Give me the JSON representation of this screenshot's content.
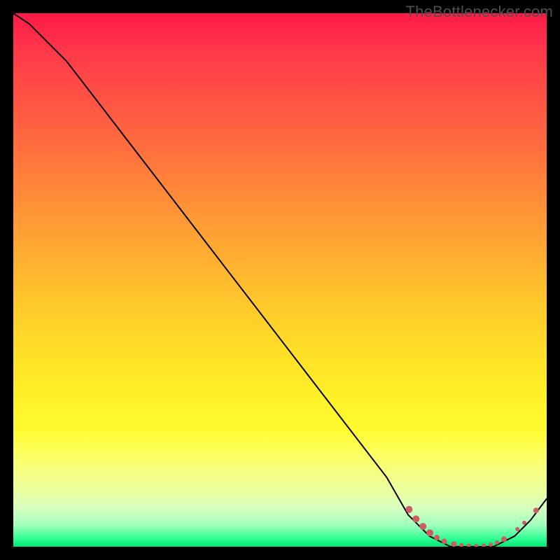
{
  "watermark": "TheBottlenecker.com",
  "colors": {
    "dot_fill": "#cd5d62",
    "dot_stroke": "#cd5d62",
    "curve_stroke": "#000000"
  },
  "chart_data": {
    "type": "line",
    "title": "",
    "xlabel": "",
    "ylabel": "",
    "xlim": [
      0,
      100
    ],
    "ylim": [
      0,
      100
    ],
    "series": [
      {
        "name": "bottleneck_curve",
        "x": [
          0,
          3,
          6,
          10,
          20,
          30,
          40,
          50,
          60,
          70,
          74,
          78,
          82,
          86,
          90,
          94,
          97,
          100
        ],
        "y": [
          100,
          98,
          95,
          91,
          78,
          65,
          52,
          39,
          26,
          13,
          6,
          2,
          0,
          0,
          0,
          2,
          5,
          9
        ]
      }
    ],
    "marker_dots": [
      {
        "x": 74.2,
        "y": 7.0,
        "r": 5
      },
      {
        "x": 75.5,
        "y": 5.2,
        "r": 5
      },
      {
        "x": 76.8,
        "y": 3.8,
        "r": 5
      },
      {
        "x": 78.1,
        "y": 2.6,
        "r": 5
      },
      {
        "x": 79.4,
        "y": 1.7,
        "r": 4
      },
      {
        "x": 80.8,
        "y": 1.0,
        "r": 4
      },
      {
        "x": 82.6,
        "y": 0.5,
        "r": 4
      },
      {
        "x": 84.0,
        "y": 0.3,
        "r": 3
      },
      {
        "x": 85.4,
        "y": 0.2,
        "r": 3
      },
      {
        "x": 86.8,
        "y": 0.15,
        "r": 3
      },
      {
        "x": 88.2,
        "y": 0.2,
        "r": 3
      },
      {
        "x": 89.5,
        "y": 0.4,
        "r": 3
      },
      {
        "x": 90.7,
        "y": 0.8,
        "r": 3
      },
      {
        "x": 92.0,
        "y": 1.4,
        "r": 4
      },
      {
        "x": 94.5,
        "y": 3.3,
        "r": 3
      },
      {
        "x": 95.8,
        "y": 4.5,
        "r": 3
      },
      {
        "x": 98.0,
        "y": 6.8,
        "r": 4
      }
    ]
  }
}
